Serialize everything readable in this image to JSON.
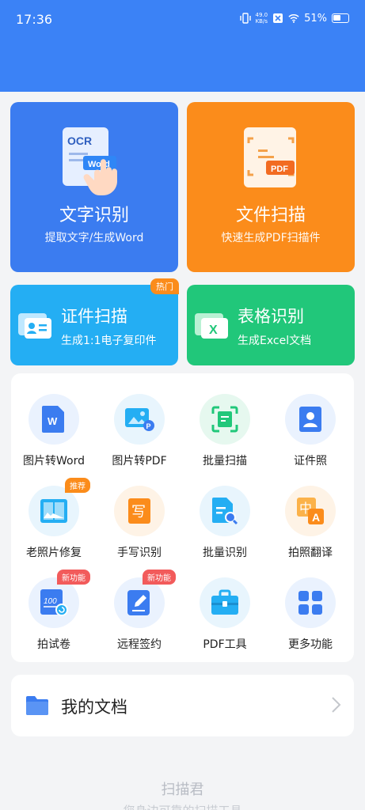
{
  "status": {
    "time": "17:36",
    "speed_value": "49.0",
    "speed_unit": "KB/s",
    "battery": "51%"
  },
  "cards": {
    "ocr": {
      "title": "文字识别",
      "sub": "提取文字/生成Word",
      "art_ocr": "OCR",
      "art_word": "Word"
    },
    "scan": {
      "title": "文件扫描",
      "sub": "快速生成PDF扫描件",
      "art_pdf": "PDF"
    },
    "id": {
      "title": "证件扫描",
      "sub": "生成1:1电子复印件",
      "badge": "热门"
    },
    "table": {
      "title": "表格识别",
      "sub": "生成Excel文档",
      "art_x": "X"
    }
  },
  "tools": [
    {
      "label": "图片转Word",
      "icon": "word-doc-icon"
    },
    {
      "label": "图片转PDF",
      "icon": "image-pdf-icon"
    },
    {
      "label": "批量扫描",
      "icon": "batch-scan-icon"
    },
    {
      "label": "证件照",
      "icon": "id-photo-icon"
    },
    {
      "label": "老照片修复",
      "icon": "photo-restore-icon",
      "badge": "推荐"
    },
    {
      "label": "手写识别",
      "icon": "handwriting-icon",
      "glyph": "写"
    },
    {
      "label": "批量识别",
      "icon": "batch-recognize-icon"
    },
    {
      "label": "拍照翻译",
      "icon": "translate-icon",
      "glyph": "中",
      "glyph2": "A"
    },
    {
      "label": "拍试卷",
      "icon": "exam-paper-icon",
      "badge": "新功能",
      "glyph": "100"
    },
    {
      "label": "远程签约",
      "icon": "pen-sign-icon",
      "badge": "新功能"
    },
    {
      "label": "PDF工具",
      "icon": "toolbox-icon"
    },
    {
      "label": "更多功能",
      "icon": "grid-more-icon"
    }
  ],
  "docs": {
    "title": "我的文档"
  },
  "footer": {
    "title": "扫描君",
    "sub": "您身边可靠的扫描工具"
  },
  "colors": {
    "brand": "#3b82f6",
    "orange": "#fb8c1b",
    "cyan": "#24aef3",
    "green": "#21c77a"
  }
}
